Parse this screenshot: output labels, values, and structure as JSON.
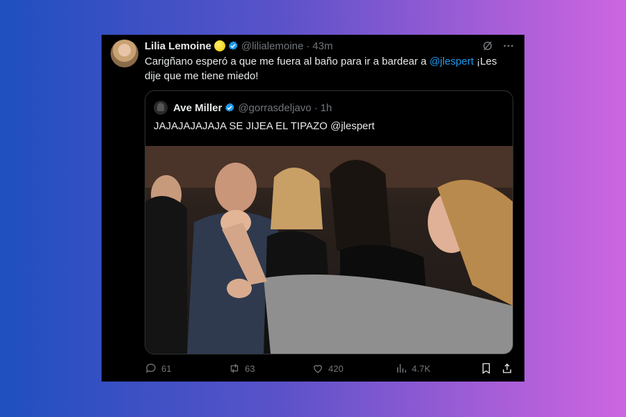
{
  "tweet": {
    "author_name": "Lilia Lemoine",
    "author_handle": "@lilialemoine",
    "time": "43m",
    "text_before": "Carigñano esperó a que me fuera al baño para ir a bardear a ",
    "mention": "@jlespert",
    "text_after": "  ¡Les dije que me tiene miedo!"
  },
  "quote": {
    "author_name": "Ave Miller",
    "author_handle": "@gorrasdeljavo",
    "time": "1h",
    "text": "JAJAJAJAJAJA SE JIJEA EL TIPAZO  @jlespert"
  },
  "actions": {
    "replies": "61",
    "retweets": "63",
    "likes": "420",
    "views": "4.7K"
  },
  "colors": {
    "accent": "#1d9bf0",
    "muted": "#71767b",
    "text": "#e7e9ea",
    "background": "#000000"
  },
  "icons": [
    "verified-icon",
    "grok-icon",
    "more-icon",
    "reply-icon",
    "retweet-icon",
    "like-icon",
    "views-icon",
    "bookmark-icon",
    "share-icon"
  ]
}
